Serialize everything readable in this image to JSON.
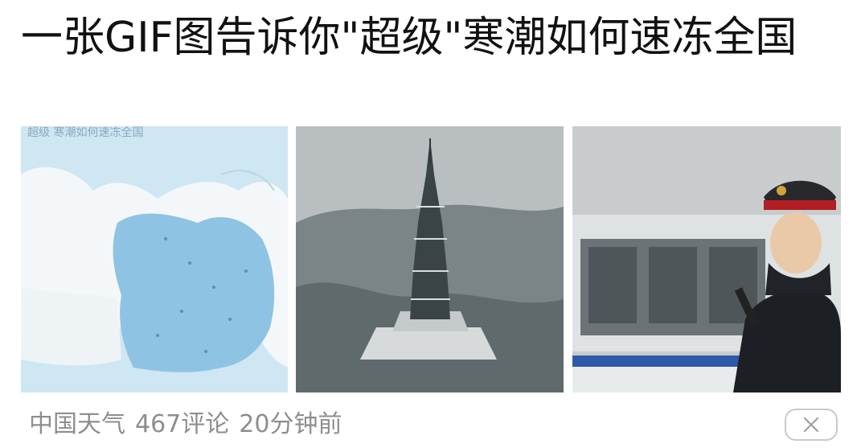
{
  "article": {
    "title": "一张GIF图告诉你\"超级\"寒潮如何速冻全国",
    "source": "中国天气",
    "comments": "467评论",
    "time": "20分钟前",
    "close_icon": "close-icon"
  },
  "images": [
    {
      "name": "cold-wave-map-image"
    },
    {
      "name": "frozen-pagoda-image"
    },
    {
      "name": "railway-staff-snow-image"
    }
  ]
}
